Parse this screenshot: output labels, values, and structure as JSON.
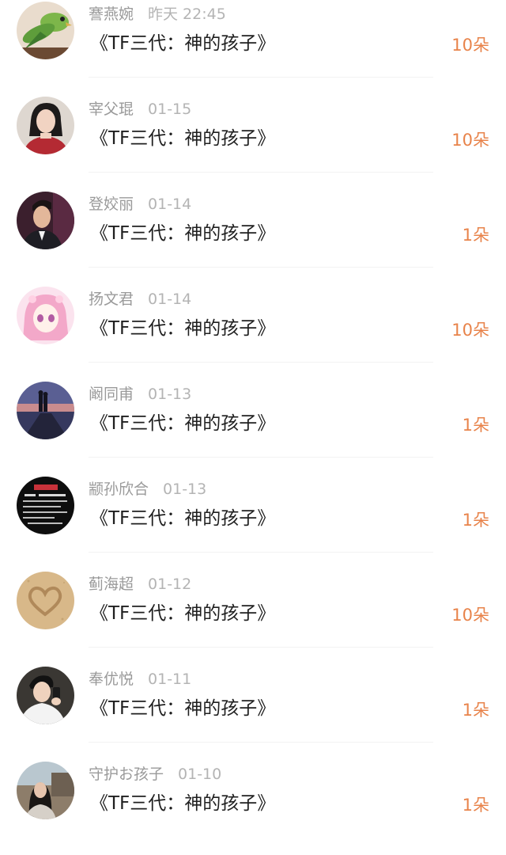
{
  "records": [
    {
      "name": "謇燕婉",
      "date": "昨天 22:45",
      "book": "《TF三代：神的孩子》",
      "count": "10朵",
      "avatar": "parrot-photo"
    },
    {
      "name": "宰父琨",
      "date": "01-15",
      "book": "《TF三代：神的孩子》",
      "count": "10朵",
      "avatar": "woman-portrait-photo"
    },
    {
      "name": "登姣丽",
      "date": "01-14",
      "book": "《TF三代：神的孩子》",
      "count": "1朵",
      "avatar": "man-portrait-photo"
    },
    {
      "name": "扬文君",
      "date": "01-14",
      "book": "《TF三代：神的孩子》",
      "count": "10朵",
      "avatar": "anime-girl-illustration"
    },
    {
      "name": "阚同甫",
      "date": "01-13",
      "book": "《TF三代：神的孩子》",
      "count": "1朵",
      "avatar": "couple-sunset-photo"
    },
    {
      "name": "颛孙欣合",
      "date": "01-13",
      "book": "《TF三代：神的孩子》",
      "count": "1朵",
      "avatar": "calligraphy-text-image"
    },
    {
      "name": "蓟海超",
      "date": "01-12",
      "book": "《TF三代：神的孩子》",
      "count": "10朵",
      "avatar": "sand-heart-photo"
    },
    {
      "name": "奉优悦",
      "date": "01-11",
      "book": "《TF三代：神的孩子》",
      "count": "1朵",
      "avatar": "man-with-phone-photo"
    },
    {
      "name": "守护お孩子",
      "date": "01-10",
      "book": "《TF三代：神的孩子》",
      "count": "1朵",
      "avatar": "girl-outdoors-photo"
    }
  ],
  "colors": {
    "accent": "#e8834a",
    "meta": "#9a9a9a",
    "title": "#1f1f1f",
    "divider": "#f2f2f2"
  }
}
